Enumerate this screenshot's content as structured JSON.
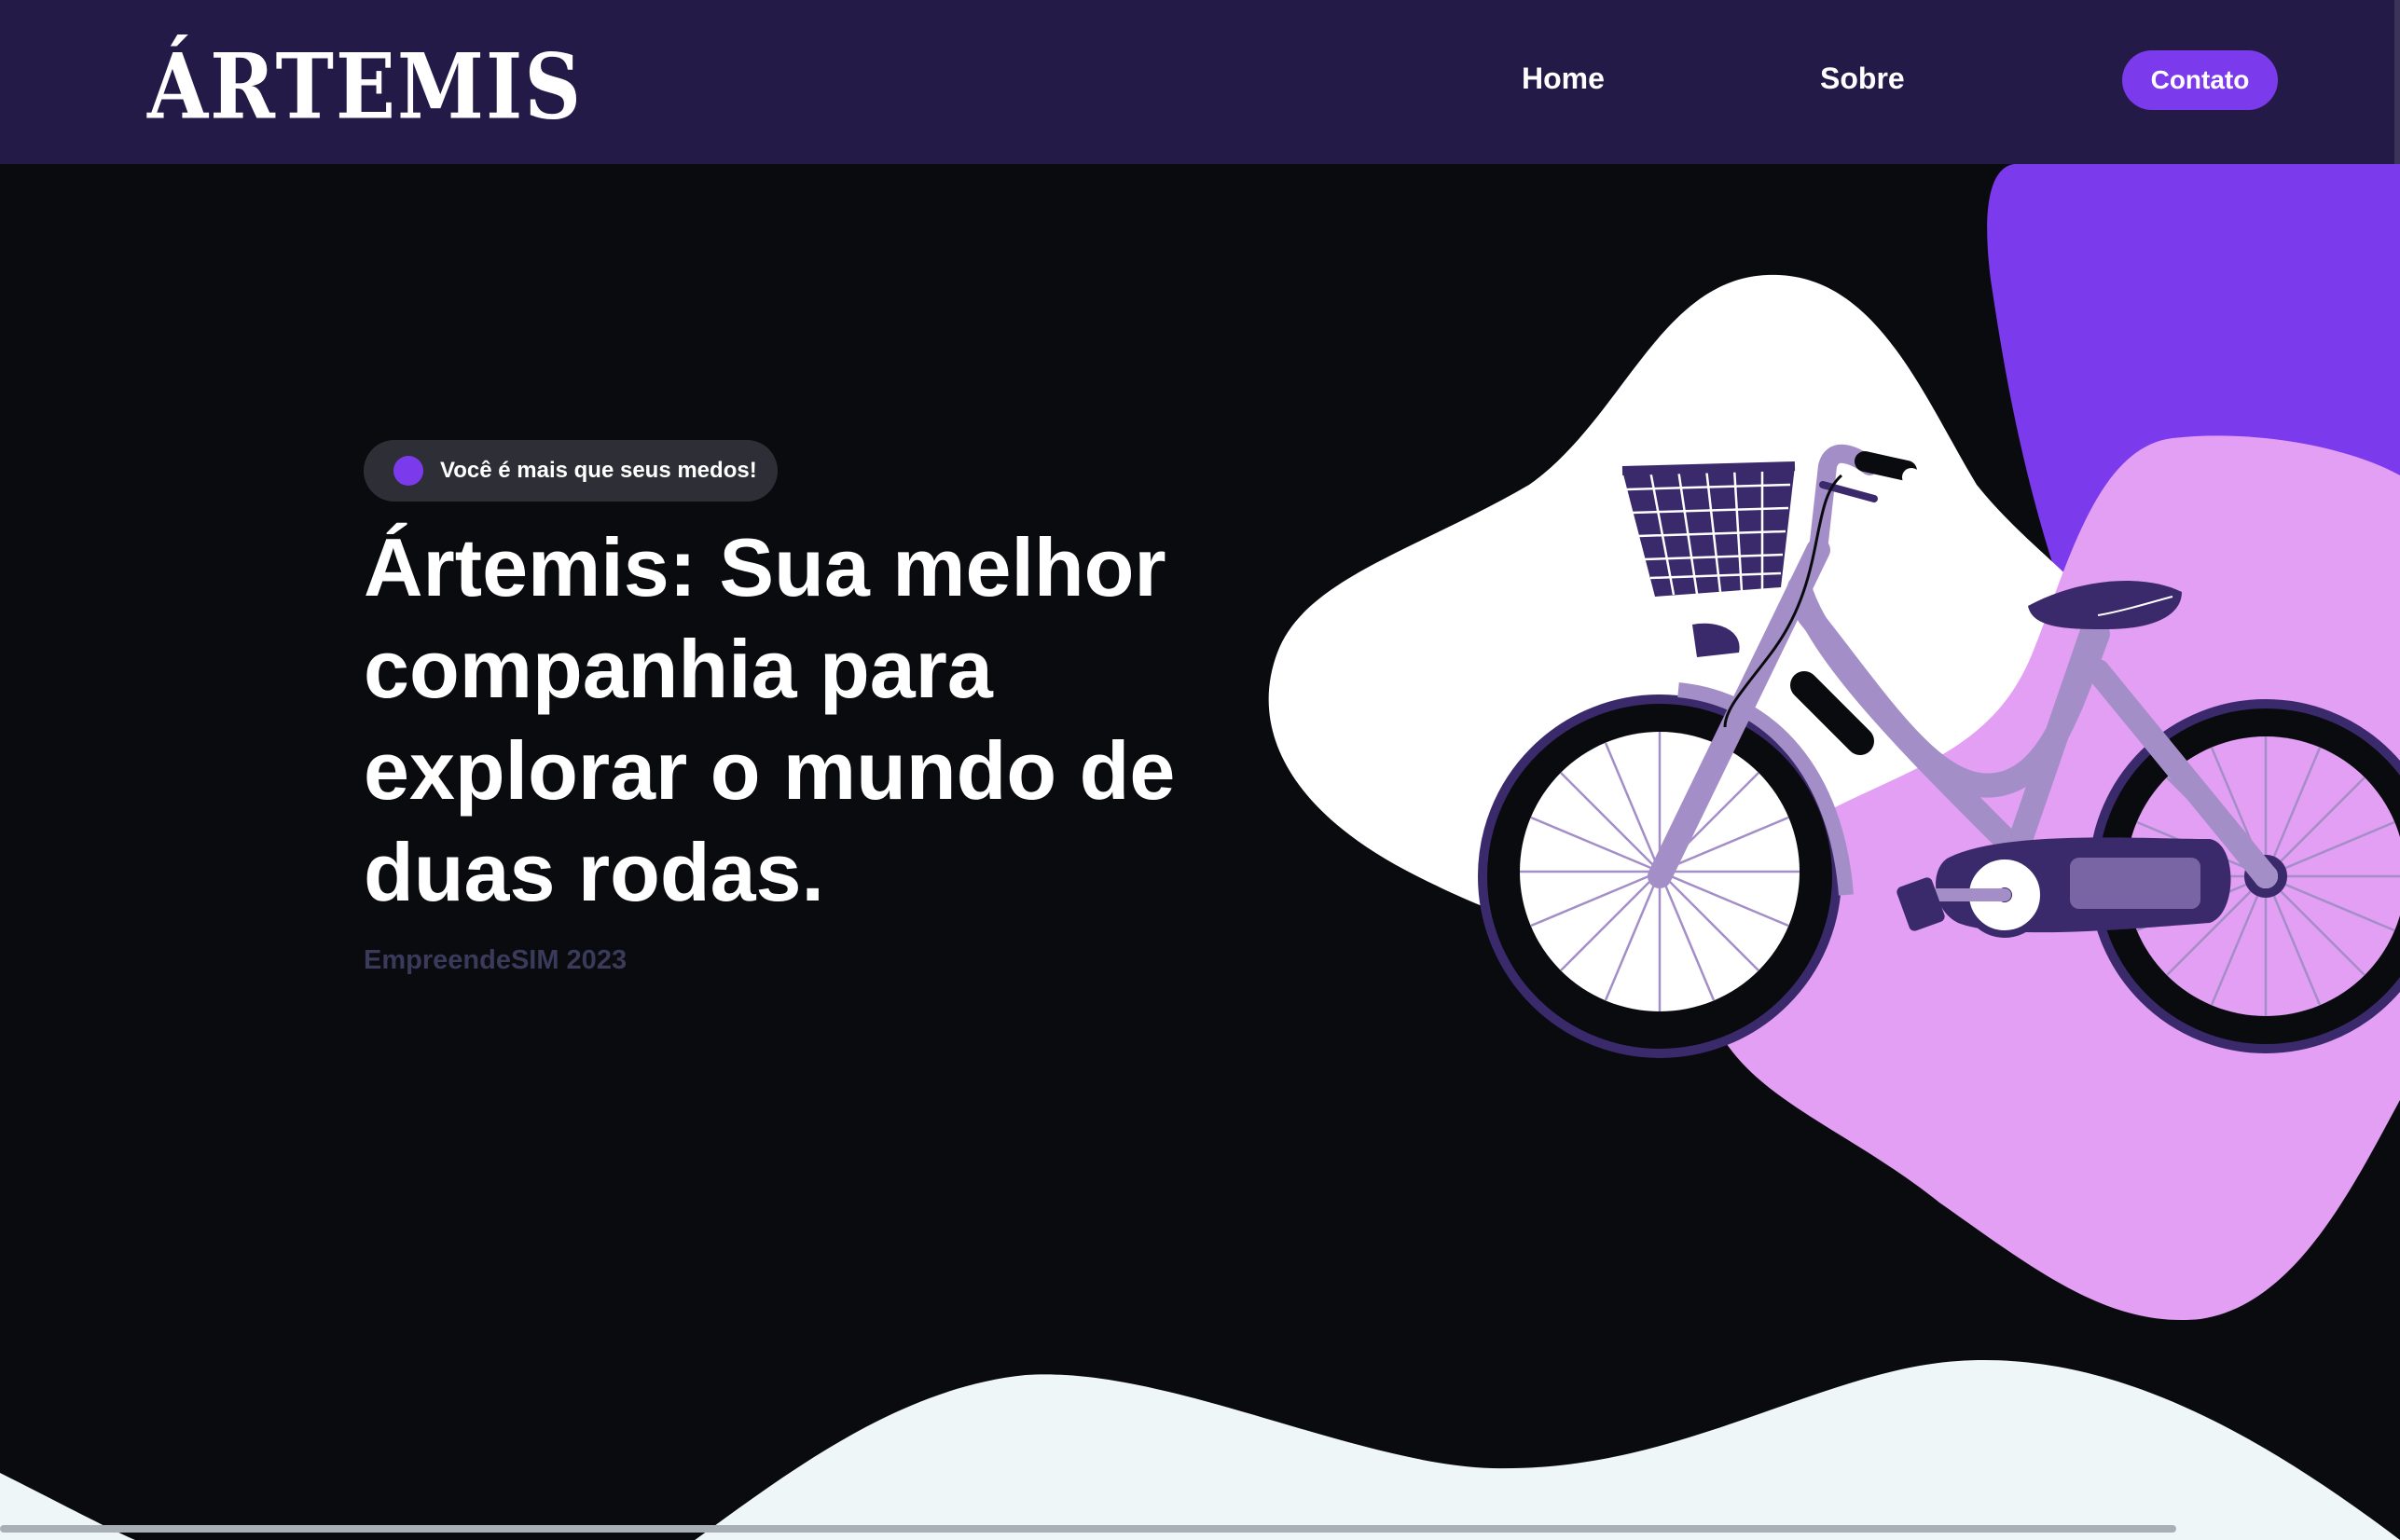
{
  "header": {
    "logo": "ÁRTEMIS",
    "nav": {
      "home": "Home",
      "sobre": "Sobre",
      "contato": "Contato"
    }
  },
  "hero": {
    "badge": "Você é mais que seus medos!",
    "title": "Ártemis: Sua melhor companhia para explorar o mundo de duas rodas.",
    "subtitle": "EmpreendeSIM 2023"
  },
  "colors": {
    "header_bg": "#241a48",
    "page_bg": "#0a0b0f",
    "accent": "#7c3aed",
    "blob_pink": "#e39ff4",
    "blob_purple": "#7c3aed",
    "bike_lilac": "#a48ec8",
    "bike_dark": "#3b2a6b",
    "wave": "#eff6f8"
  }
}
